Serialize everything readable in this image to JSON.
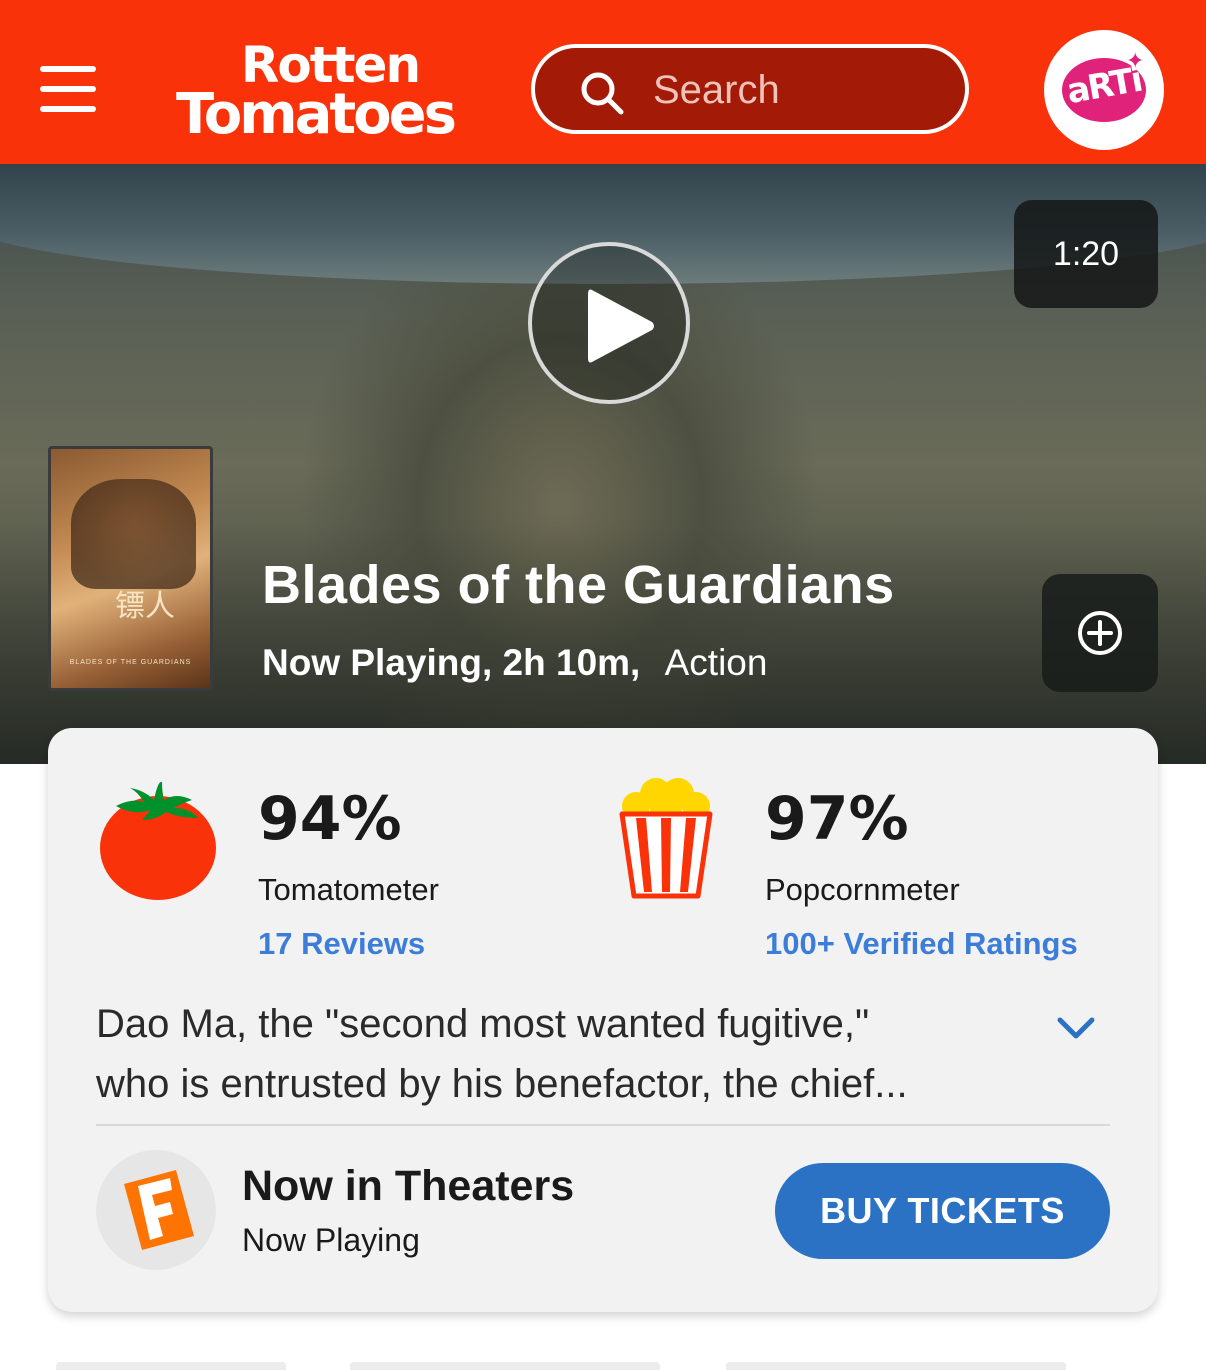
{
  "header": {
    "logo_line1": "Rotten",
    "logo_line2": "Tomatoes",
    "search_placeholder": "Search",
    "avatar_text": "aRTi",
    "brand_color": "#fa320a"
  },
  "hero": {
    "video_duration": "1:20",
    "poster_title_char": "镖人",
    "poster_caption": "BLADES OF THE GUARDIANS",
    "title": "Blades of the Guardians",
    "status": "Now Playing,",
    "runtime": "2h 10m,",
    "genre": "Action"
  },
  "scores": {
    "tomatometer": {
      "value": "94%",
      "label": "Tomatometer",
      "link": "17 Reviews",
      "icon": "tomato-icon"
    },
    "popcornmeter": {
      "value": "97%",
      "label": "Popcornmeter",
      "link": "100+ Verified Ratings",
      "icon": "popcorn-icon"
    }
  },
  "synopsis": {
    "line1": "Dao Ma, the \"second most wanted fugitive,\"",
    "line2": "who is entrusted by his benefactor, the chief..."
  },
  "theaters": {
    "title": "Now in Theaters",
    "subtitle": "Now Playing",
    "button": "BUY TICKETS",
    "icon": "fandango-icon",
    "button_color": "#2b72c4"
  }
}
